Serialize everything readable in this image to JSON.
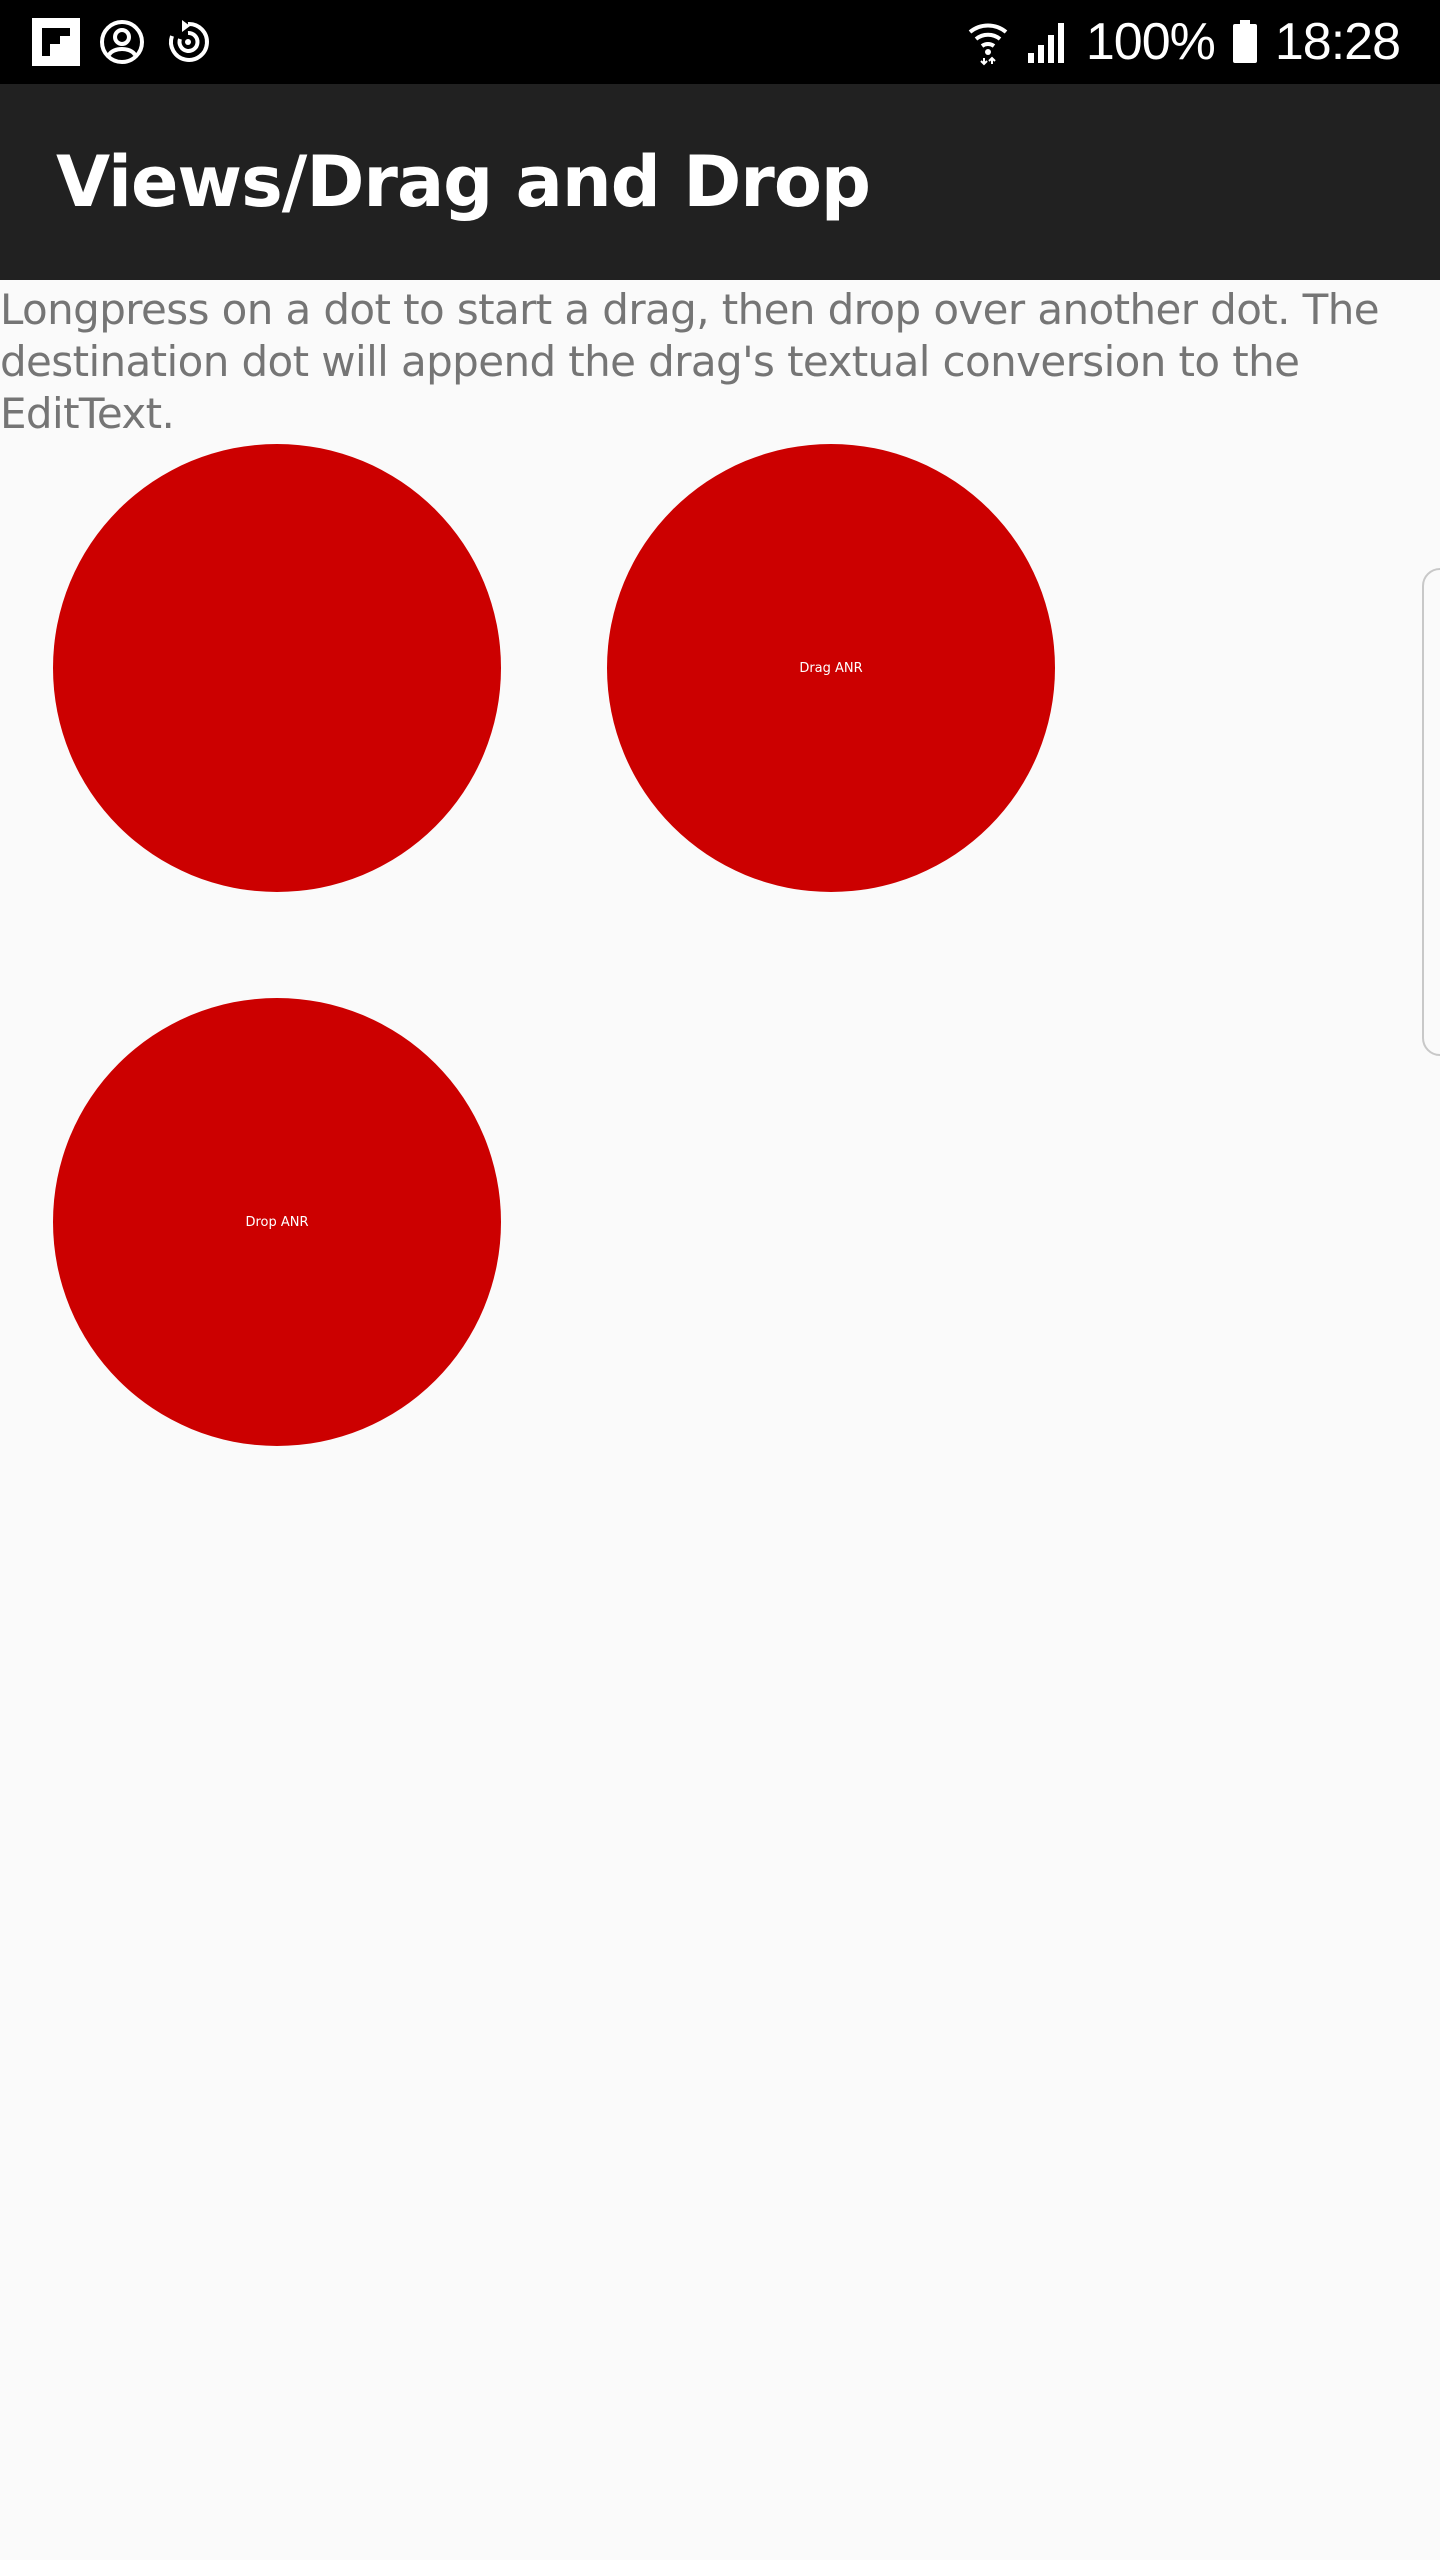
{
  "status_bar": {
    "icons_left": [
      "flipboard-icon",
      "account-circle-icon",
      "sync-icon"
    ],
    "icons_right": [
      "wifi-icon",
      "signal-icon",
      "battery-icon"
    ],
    "battery": "100%",
    "time": "18:28"
  },
  "app_bar": {
    "title": "Views/Drag and Drop"
  },
  "content": {
    "description": "Longpress on a dot to start a drag, then drop over another dot. The destination dot will append the drag's textual conversion to the EditText.",
    "dots": [
      {
        "label": ""
      },
      {
        "label": "Drag ANR"
      },
      {
        "label": "Drop ANR"
      }
    ]
  },
  "colors": {
    "dot": "#cc0000",
    "app_bar": "#212121",
    "background": "#fafafa",
    "status_bar": "#000000"
  }
}
